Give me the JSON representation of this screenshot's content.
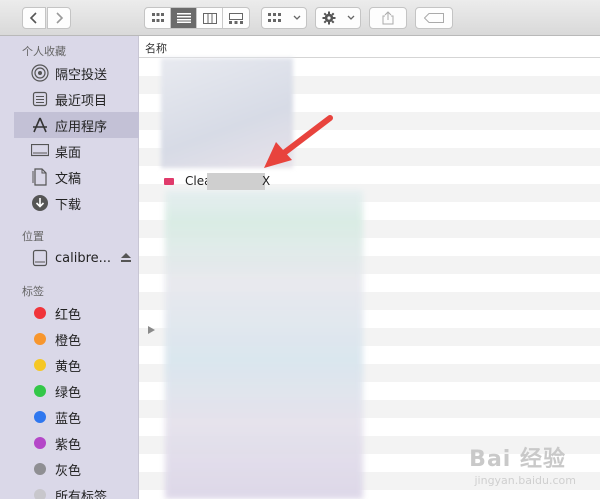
{
  "toolbar": {
    "back_icon": "chevron-left-icon",
    "forward_icon": "chevron-right-icon",
    "view_modes": [
      "icon-view",
      "list-view",
      "column-view",
      "gallery-view"
    ],
    "active_view": "list-view",
    "arrange_icon": "grid-arrange-icon",
    "action_icon": "gear-icon",
    "share_icon": "share-icon",
    "tag_icon": "tag-icon"
  },
  "sidebar": {
    "favorites_title": "个人收藏",
    "favorites": [
      {
        "label": "隔空投送",
        "icon": "airdrop-icon"
      },
      {
        "label": "最近项目",
        "icon": "recents-icon"
      },
      {
        "label": "应用程序",
        "icon": "applications-icon",
        "selected": true
      },
      {
        "label": "桌面",
        "icon": "desktop-icon"
      },
      {
        "label": "文稿",
        "icon": "documents-icon"
      },
      {
        "label": "下载",
        "icon": "downloads-icon"
      }
    ],
    "locations_title": "位置",
    "locations": [
      {
        "label": "calibre...",
        "icon": "disk-icon",
        "eject": "eject-icon"
      }
    ],
    "tags_title": "标签",
    "tags": [
      {
        "label": "红色",
        "color": "#f0343a"
      },
      {
        "label": "橙色",
        "color": "#f7962d"
      },
      {
        "label": "黄色",
        "color": "#f5c724"
      },
      {
        "label": "绿色",
        "color": "#33c748"
      },
      {
        "label": "蓝色",
        "color": "#2f77ef"
      },
      {
        "label": "紫色",
        "color": "#b447c8"
      },
      {
        "label": "灰色",
        "color": "#8f8f93"
      },
      {
        "label": "所有标签...",
        "color": "#c8c7cc"
      }
    ]
  },
  "main": {
    "column_name": "名称",
    "visible_item": {
      "name_start": "Clea",
      "name_end": "X",
      "icon": "app-icon"
    }
  },
  "watermark": {
    "text": "Bai 经验",
    "sub": "jingyan.baidu.com"
  }
}
